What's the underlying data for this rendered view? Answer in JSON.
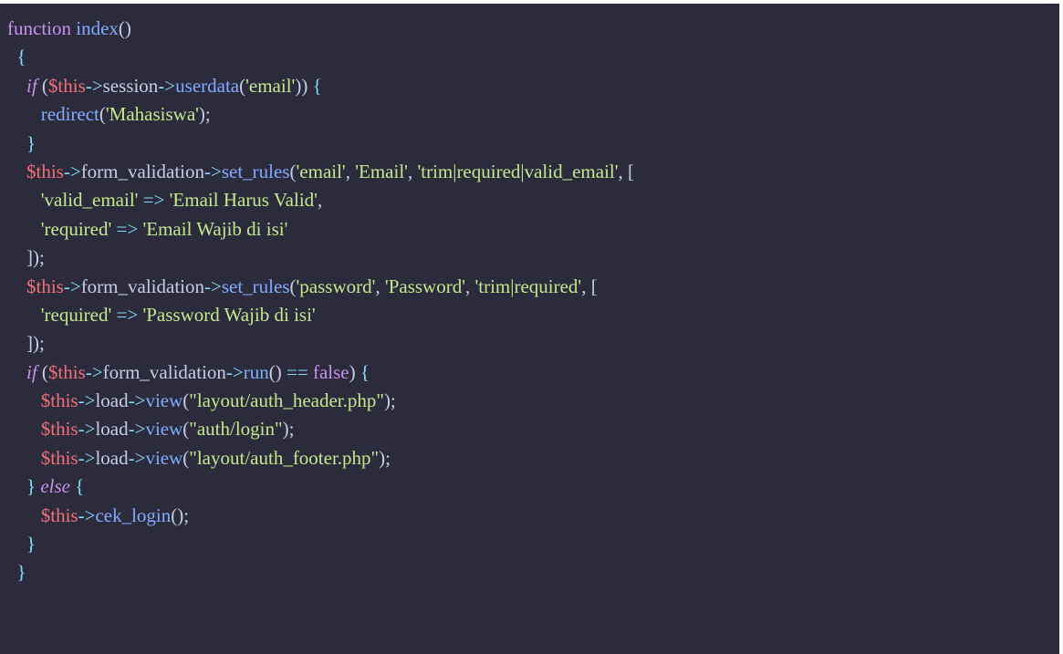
{
  "theme": {
    "background": "#2b2b3c",
    "keyword": "#c792ea",
    "function": "#82aaff",
    "variable": "#f07178",
    "operator": "#89ddff",
    "string": "#c3e88d",
    "punctuation": "#c8cde6"
  },
  "code": {
    "lines": [
      [
        [
          "keyword",
          "function"
        ],
        [
          "plain",
          " "
        ],
        [
          "function",
          "index"
        ],
        [
          "punct",
          "()"
        ]
      ],
      [
        [
          "plain",
          "  "
        ],
        [
          "operator",
          "{"
        ]
      ],
      [
        [
          "plain",
          "    "
        ],
        [
          "keyword-italic",
          "if"
        ],
        [
          "plain",
          " "
        ],
        [
          "punct",
          "("
        ],
        [
          "variable",
          "$this"
        ],
        [
          "operator",
          "->"
        ],
        [
          "plain",
          "session"
        ],
        [
          "operator",
          "->"
        ],
        [
          "function",
          "userdata"
        ],
        [
          "punct",
          "("
        ],
        [
          "string",
          "'email'"
        ],
        [
          "punct",
          "))"
        ],
        [
          "plain",
          " "
        ],
        [
          "operator",
          "{"
        ]
      ],
      [
        [
          "plain",
          "       "
        ],
        [
          "function",
          "redirect"
        ],
        [
          "punct",
          "("
        ],
        [
          "string",
          "'Mahasiswa'"
        ],
        [
          "punct",
          ");"
        ]
      ],
      [
        [
          "plain",
          "    "
        ],
        [
          "operator",
          "}"
        ]
      ],
      [
        [
          "plain",
          "    "
        ],
        [
          "variable",
          "$this"
        ],
        [
          "operator",
          "->"
        ],
        [
          "plain",
          "form_validation"
        ],
        [
          "operator",
          "->"
        ],
        [
          "function",
          "set_rules"
        ],
        [
          "punct",
          "("
        ],
        [
          "string",
          "'email'"
        ],
        [
          "punct",
          ", "
        ],
        [
          "string",
          "'Email'"
        ],
        [
          "punct",
          ", "
        ],
        [
          "string",
          "'trim|required|valid_email'"
        ],
        [
          "punct",
          ", ["
        ]
      ],
      [
        [
          "plain",
          "       "
        ],
        [
          "string",
          "'valid_email'"
        ],
        [
          "plain",
          " "
        ],
        [
          "operator",
          "=>"
        ],
        [
          "plain",
          " "
        ],
        [
          "string",
          "'Email Harus Valid'"
        ],
        [
          "punct",
          ","
        ]
      ],
      [
        [
          "plain",
          "       "
        ],
        [
          "string",
          "'required'"
        ],
        [
          "plain",
          " "
        ],
        [
          "operator",
          "=>"
        ],
        [
          "plain",
          " "
        ],
        [
          "string",
          "'Email Wajib di isi'"
        ]
      ],
      [
        [
          "plain",
          "    "
        ],
        [
          "punct",
          "]);"
        ]
      ],
      [
        [
          "plain",
          "    "
        ],
        [
          "variable",
          "$this"
        ],
        [
          "operator",
          "->"
        ],
        [
          "plain",
          "form_validation"
        ],
        [
          "operator",
          "->"
        ],
        [
          "function",
          "set_rules"
        ],
        [
          "punct",
          "("
        ],
        [
          "string",
          "'password'"
        ],
        [
          "punct",
          ", "
        ],
        [
          "string",
          "'Password'"
        ],
        [
          "punct",
          ", "
        ],
        [
          "string",
          "'trim|required'"
        ],
        [
          "punct",
          ", ["
        ]
      ],
      [
        [
          "plain",
          "       "
        ],
        [
          "string",
          "'required'"
        ],
        [
          "plain",
          " "
        ],
        [
          "operator",
          "=>"
        ],
        [
          "plain",
          " "
        ],
        [
          "string",
          "'Password Wajib di isi'"
        ]
      ],
      [
        [
          "plain",
          "    "
        ],
        [
          "punct",
          "]);"
        ]
      ],
      [
        [
          "plain",
          "    "
        ],
        [
          "keyword-italic",
          "if"
        ],
        [
          "plain",
          " "
        ],
        [
          "punct",
          "("
        ],
        [
          "variable",
          "$this"
        ],
        [
          "operator",
          "->"
        ],
        [
          "plain",
          "form_validation"
        ],
        [
          "operator",
          "->"
        ],
        [
          "function",
          "run"
        ],
        [
          "punct",
          "()"
        ],
        [
          "plain",
          " "
        ],
        [
          "operator",
          "=="
        ],
        [
          "plain",
          " "
        ],
        [
          "boolean",
          "false"
        ],
        [
          "punct",
          ")"
        ],
        [
          "plain",
          " "
        ],
        [
          "operator",
          "{"
        ]
      ],
      [
        [
          "plain",
          "       "
        ],
        [
          "variable",
          "$this"
        ],
        [
          "operator",
          "->"
        ],
        [
          "plain",
          "load"
        ],
        [
          "operator",
          "->"
        ],
        [
          "function",
          "view"
        ],
        [
          "punct",
          "("
        ],
        [
          "string",
          "\"layout/auth_header.php\""
        ],
        [
          "punct",
          ");"
        ]
      ],
      [
        [
          "plain",
          "       "
        ],
        [
          "variable",
          "$this"
        ],
        [
          "operator",
          "->"
        ],
        [
          "plain",
          "load"
        ],
        [
          "operator",
          "->"
        ],
        [
          "function",
          "view"
        ],
        [
          "punct",
          "("
        ],
        [
          "string",
          "\"auth/login\""
        ],
        [
          "punct",
          ");"
        ]
      ],
      [
        [
          "plain",
          "       "
        ],
        [
          "variable",
          "$this"
        ],
        [
          "operator",
          "->"
        ],
        [
          "plain",
          "load"
        ],
        [
          "operator",
          "->"
        ],
        [
          "function",
          "view"
        ],
        [
          "punct",
          "("
        ],
        [
          "string",
          "\"layout/auth_footer.php\""
        ],
        [
          "punct",
          ");"
        ]
      ],
      [
        [
          "plain",
          "    "
        ],
        [
          "operator",
          "}"
        ],
        [
          "plain",
          " "
        ],
        [
          "keyword-italic",
          "else"
        ],
        [
          "plain",
          " "
        ],
        [
          "operator",
          "{"
        ]
      ],
      [
        [
          "plain",
          "       "
        ],
        [
          "variable",
          "$this"
        ],
        [
          "operator",
          "->"
        ],
        [
          "function",
          "cek_login"
        ],
        [
          "punct",
          "();"
        ]
      ],
      [
        [
          "plain",
          "    "
        ],
        [
          "operator",
          "}"
        ]
      ],
      [
        [
          "plain",
          "  "
        ],
        [
          "operator",
          "}"
        ]
      ]
    ]
  }
}
